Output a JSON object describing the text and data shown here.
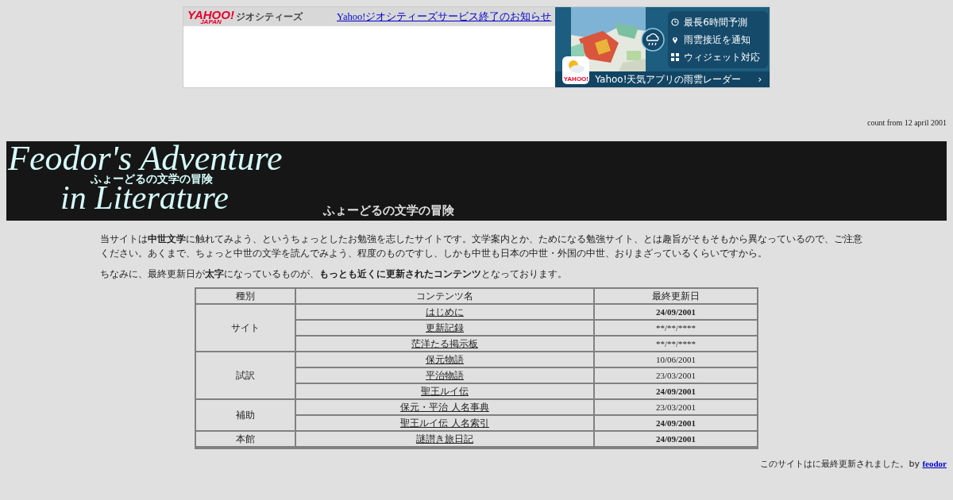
{
  "ad": {
    "logo": "YAHOO!",
    "logo_sub": "JAPAN",
    "service": "ジオシティーズ",
    "notice_link": "Yahoo!ジオシティーズサービス終了のお知らせ",
    "features": [
      "最長6時間予測",
      "雨雲接近を通知",
      "ウィジェット対応"
    ],
    "app_label": "YAHOO!",
    "caption": "Yahoo!天気アプリの雨雲レーダー",
    "caption_arrow": "›"
  },
  "counter": "count from 12 april 2001",
  "banner": {
    "title_line_1": "Feodor's Adventure",
    "subtitle_small": "ふょーどるの文学の冒険",
    "title_line_2": "in Literature",
    "subtitle": "ふょーどるの文学の冒険"
  },
  "intro": [
    "当サイトは**中世文学**に触れてみよう、というちょっとしたお勉強を志したサイトです。文学案内とか、ためになる勉強サイト、とは趣旨がそもそもから異なっているので、ご注意ください。あくまで、ちょっと中世の文学を読んでみよう、程度のものですし、しかも中世も日本の中世・外国の中世、おりまざっているくらいですから。",
    "ちなみに、最終更新日が**太字**になっているものが、**もっとも近くに更新されたコンテンツ**となっております。"
  ],
  "table": {
    "columns": [
      "種別",
      "コンテンツ名",
      "最終更新日"
    ],
    "groups": [
      {
        "category": "サイト",
        "rows": [
          {
            "name": "はじめに",
            "date": "24/09/2001",
            "recent": true
          },
          {
            "name": "更新記録",
            "date": "**/**/****",
            "recent": false
          },
          {
            "name": "茫洋たる掲示板",
            "date": "**/**/****",
            "recent": false
          }
        ]
      },
      {
        "category": "試訳",
        "rows": [
          {
            "name": "保元物語",
            "date": "10/06/2001",
            "recent": false
          },
          {
            "name": "平治物語",
            "date": "23/03/2001",
            "recent": false
          },
          {
            "name": "聖王ルイ伝",
            "date": "24/09/2001",
            "recent": true
          }
        ]
      },
      {
        "category": "補助",
        "rows": [
          {
            "name": "保元・平治 人名事典",
            "date": "23/03/2001",
            "recent": false
          },
          {
            "name": "聖王ルイ伝 人名索引",
            "date": "24/09/2001",
            "recent": true
          }
        ]
      },
      {
        "category": "本館",
        "rows": [
          {
            "name": "謎讃き旅日記",
            "date": "24/09/2001",
            "recent": true
          }
        ]
      }
    ]
  },
  "footer": {
    "text": "このサイトはに最終更新されました。by",
    "author_link": "feodor"
  }
}
